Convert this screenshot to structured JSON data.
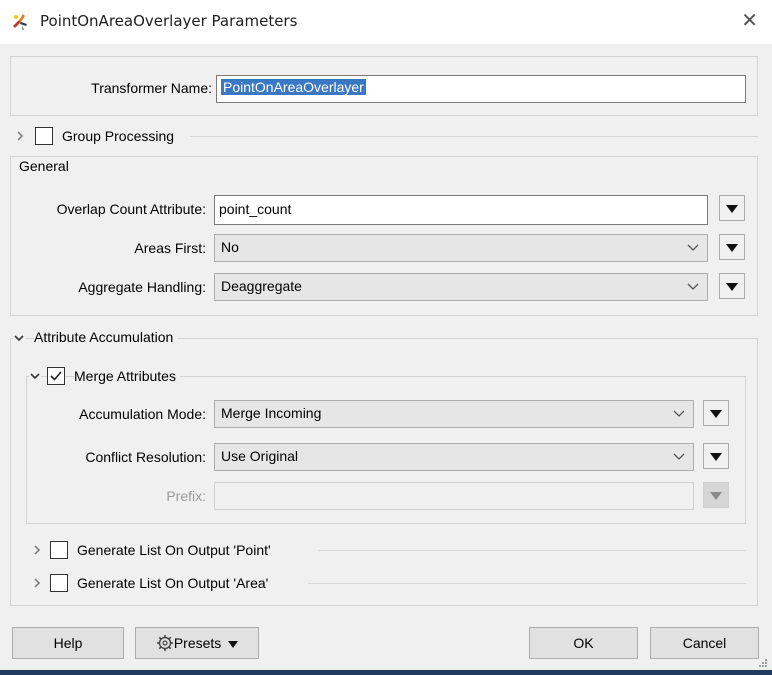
{
  "window": {
    "title": "PointOnAreaOverlayer Parameters",
    "close_glyph": "✕"
  },
  "transformer_name": {
    "label": "Transformer Name:",
    "value": "PointOnAreaOverlayer"
  },
  "group_processing": {
    "label": "Group Processing",
    "checked": false
  },
  "general": {
    "title": "General",
    "overlap_count": {
      "label": "Overlap Count Attribute:",
      "value": "point_count"
    },
    "areas_first": {
      "label": "Areas First:",
      "value": "No"
    },
    "aggregate_handling": {
      "label": "Aggregate Handling:",
      "value": "Deaggregate"
    }
  },
  "attribute_accumulation": {
    "title": "Attribute Accumulation",
    "merge_attributes": {
      "label": "Merge Attributes",
      "checked": true,
      "accumulation_mode": {
        "label": "Accumulation Mode:",
        "value": "Merge Incoming"
      },
      "conflict_resolution": {
        "label": "Conflict Resolution:",
        "value": "Use Original"
      },
      "prefix": {
        "label": "Prefix:",
        "value": ""
      }
    },
    "generate_list_point": {
      "label": "Generate List On Output 'Point'",
      "checked": false
    },
    "generate_list_area": {
      "label": "Generate List On Output 'Area'",
      "checked": false
    }
  },
  "footer": {
    "help_label": "Help",
    "presets_label": "Presets",
    "ok_label": "OK",
    "cancel_label": "Cancel"
  },
  "icons": {
    "app": "fme-transformer-icon",
    "close": "close-icon",
    "collapsed": "chevron-right-icon",
    "expanded": "chevron-down-icon",
    "dropdown": "chevron-down-icon",
    "menu": "triangle-down-icon",
    "presets": "gear-icon"
  },
  "colors": {
    "selection": "#3a78c4",
    "taskbar": "#1e3a5c"
  }
}
